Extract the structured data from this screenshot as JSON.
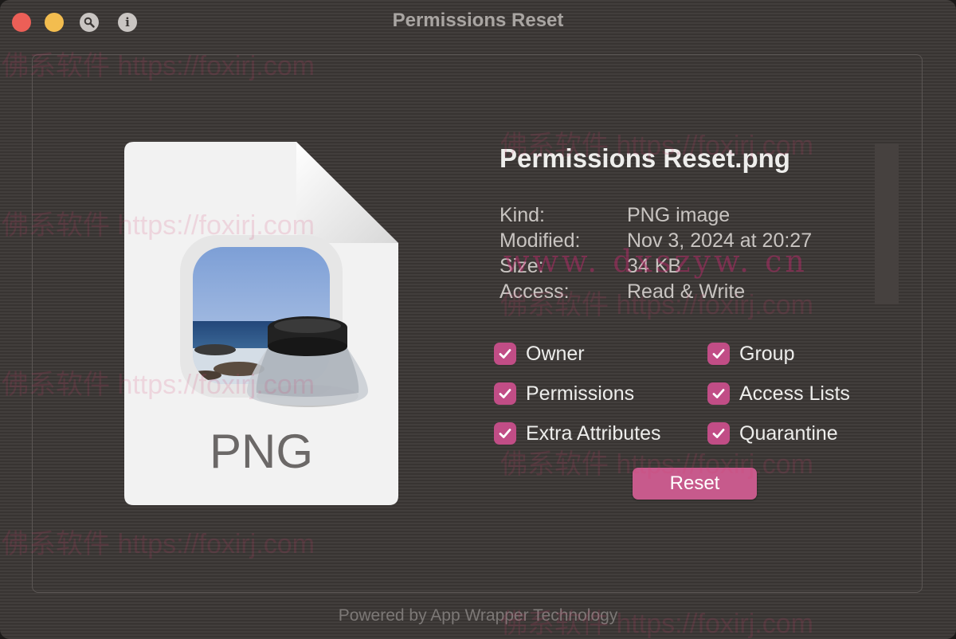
{
  "window": {
    "title": "Permissions Reset"
  },
  "titlebar_icons": {
    "search": "magnifier-icon",
    "info": "i"
  },
  "file": {
    "name": "Permissions Reset.png",
    "type_label": "PNG",
    "icon": "png-document-with-preview-app-icon"
  },
  "info": {
    "kind_label": "Kind:",
    "kind_value": "PNG image",
    "modified_label": "Modified:",
    "modified_value": "Nov 3, 2024 at 20:27",
    "size_label": "Size:",
    "size_value": "34 KB",
    "access_label": "Access:",
    "access_value": "Read & Write"
  },
  "options": [
    {
      "label": "Owner",
      "checked": true
    },
    {
      "label": "Group",
      "checked": true
    },
    {
      "label": "Permissions",
      "checked": true
    },
    {
      "label": "Access Lists",
      "checked": true
    },
    {
      "label": "Extra Attributes",
      "checked": true
    },
    {
      "label": "Quarantine",
      "checked": true
    }
  ],
  "reset_label": "Reset",
  "footer": "Powered by App Wrapper Technology",
  "watermarks": {
    "foxirj": "佛系软件 https://foxirj.com",
    "dxszyw": "www. dxszyw. cn"
  },
  "colors": {
    "accent": "#c14d86",
    "button": "#c75a8c",
    "background": "#3b3735",
    "close": "#ec5f57",
    "minimize": "#f3bd4f"
  }
}
